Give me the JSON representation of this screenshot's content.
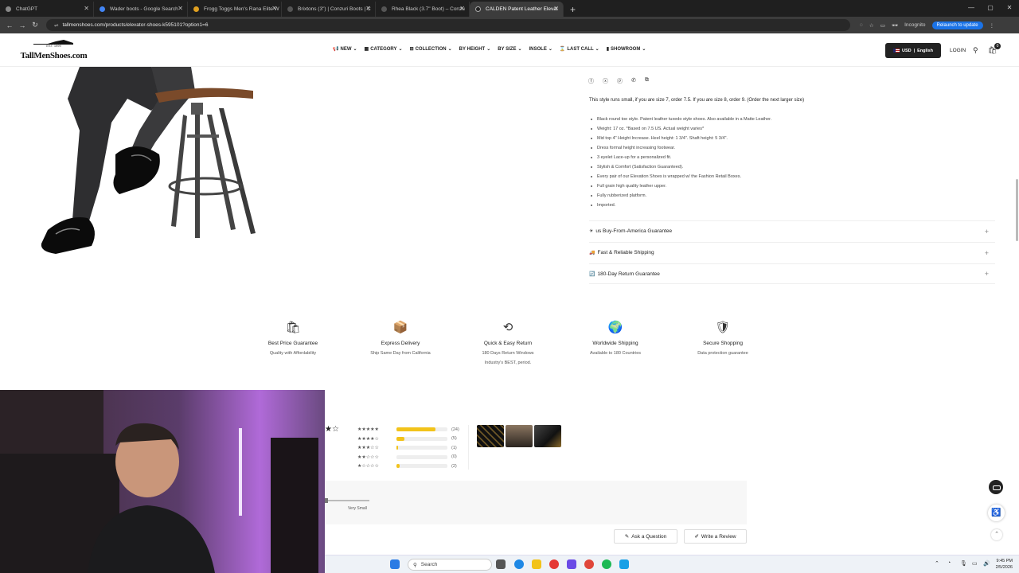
{
  "browser": {
    "tabs": [
      {
        "label": "ChatGPT",
        "active": false
      },
      {
        "label": "Wader boots - Google Search",
        "active": false
      },
      {
        "label": "Frogg Toggs Men's Rana Elite W",
        "active": false
      },
      {
        "label": "Brixtons (3\") | Conzuri Boots | C",
        "active": false
      },
      {
        "label": "Rhea Black (3.7\" Boot) – Conzu",
        "active": false
      },
      {
        "label": "CALDEN Patent Leather Elevat",
        "active": true
      }
    ],
    "url": "tallmenshoes.com/products/elevator-shoes-k595101?option1=6",
    "incognito_label": "Incognito",
    "relaunch_label": "Relaunch to update"
  },
  "site": {
    "logo_est": "EST. 1999",
    "logo_text": "TallMenShoes.com",
    "nav": [
      "NEW",
      "CATEGORY",
      "COLLECTION",
      "BY HEIGHT",
      "BY SIZE",
      "INSOLE",
      "LAST CALL",
      "SHOWROOM"
    ],
    "currency": "USD",
    "language": "English",
    "login": "LOGIN",
    "cart_count": "0"
  },
  "product": {
    "size_note": "This style runs small, if you are size 7, order 7.5. If you are size 8, order 9. (Order the next larger size)",
    "features": [
      "Black round toe style.  Patent leather tuxedo style shoes.  Also available in a Matte Leather.",
      "Weight: 17 oz.  *Based on 7.5 US.  Actual weight varies*",
      "Mid top 4\" Height Increase. Heel height: 1 3/4\".  Shaft height: 5 3/4\".",
      "Dress formal height increasing footwear.",
      " 3 eyelet Lace-up for a personalized fit.",
      "Stylish & Comfort (Satisfaction Guaranteed).",
      "Every pair of our Elevation Shoes is wrapped w/ the Fashion Retail Boxes.",
      "Full grain high quality leather upper.",
      "Fully rubberized platform.",
      "Imported."
    ],
    "accordions": [
      {
        "emoji": "☀",
        "label": "us Buy-From-America Guarantee"
      },
      {
        "emoji": "🚚",
        "label": "Fast & Reliable Shipping"
      },
      {
        "emoji": "🔄",
        "label": "180-Day Return Guarantee"
      }
    ]
  },
  "guarantees": [
    {
      "title": "Best Price Guarantee",
      "sub": "Quality with Affordability",
      "sub2": ""
    },
    {
      "title": "Express Delivery",
      "sub": "Ship Same Day from California",
      "sub2": ""
    },
    {
      "title": "Quick & Easy Return",
      "sub": "180 Days Return Windows",
      "sub2": "Industry's BEST, period."
    },
    {
      "title": "Worldwide Shipping",
      "sub": "Available to 180 Countries",
      "sub2": ""
    },
    {
      "title": "Secure Shopping",
      "sub": "Data protection guarantee",
      "sub2": ""
    }
  ],
  "reviews": {
    "rows": [
      {
        "stars": "★★★★★",
        "count": "(24)",
        "fraction": 0.77
      },
      {
        "stars": "★★★★☆",
        "count": "(5)",
        "fraction": 0.16
      },
      {
        "stars": "★★★☆☆",
        "count": "(1)",
        "fraction": 0.03
      },
      {
        "stars": "★★☆☆☆",
        "count": "(0)",
        "fraction": 0.0
      },
      {
        "stars": "★☆☆☆☆",
        "count": "(2)",
        "fraction": 0.06
      }
    ],
    "fit_label": "Very Small",
    "ask_label": "Ask a Question",
    "write_label": "Write a Review"
  },
  "taskbar": {
    "search": "Search",
    "time": "9:45 PM",
    "date": "2/5/2026"
  }
}
